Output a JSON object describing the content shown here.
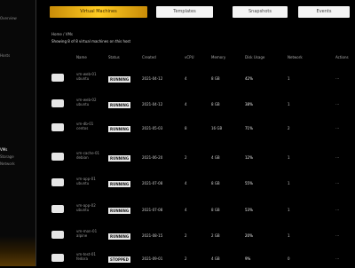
{
  "sidebar": {
    "items": [
      {
        "label": "Overview",
        "active": false
      },
      {
        "label": "Hosts",
        "active": false
      },
      {
        "label": "VMs",
        "active": true
      },
      {
        "label": "Storage",
        "active": false
      },
      {
        "label": "Network",
        "active": false
      }
    ]
  },
  "tabs": [
    {
      "label": "Virtual Machines",
      "active": true
    },
    {
      "label": "Templates",
      "active": false
    },
    {
      "label": "Snapshots",
      "active": false
    },
    {
      "label": "Events",
      "active": false
    }
  ],
  "breadcrumb": "Home / VMs",
  "caption": "Showing 8 of 8 virtual machines on this host",
  "table": {
    "headers": [
      "",
      "Name",
      "Status",
      "Created",
      "vCPU",
      "Memory",
      "Disk Usage",
      "Network",
      "Actions"
    ],
    "rows": [
      {
        "name": "vm-web-01 ubuntu",
        "status": "RUNNING",
        "created": "2021-04-12",
        "vcpu": "4",
        "memory": "8 GB",
        "disk": "42%",
        "network": "1",
        "actions": "⋯"
      },
      {
        "name": "vm-web-02 ubuntu",
        "status": "RUNNING",
        "created": "2021-04-12",
        "vcpu": "4",
        "memory": "8 GB",
        "disk": "38%",
        "network": "1",
        "actions": "⋯"
      },
      {
        "name": "vm-db-01 centos",
        "status": "RUNNING",
        "created": "2021-05-03",
        "vcpu": "8",
        "memory": "16 GB",
        "disk": "71%",
        "network": "2",
        "actions": "⋯"
      },
      {
        "name": "vm-cache-01 debian",
        "status": "RUNNING",
        "created": "2021-06-20",
        "vcpu": "2",
        "memory": "4 GB",
        "disk": "12%",
        "network": "1",
        "actions": "⋯"
      },
      {
        "name": "vm-app-01 ubuntu",
        "status": "RUNNING",
        "created": "2021-07-08",
        "vcpu": "4",
        "memory": "8 GB",
        "disk": "55%",
        "network": "1",
        "actions": "⋯"
      },
      {
        "name": "vm-app-02 ubuntu",
        "status": "RUNNING",
        "created": "2021-07-08",
        "vcpu": "4",
        "memory": "8 GB",
        "disk": "53%",
        "network": "1",
        "actions": "⋯"
      },
      {
        "name": "vm-mon-01 alpine",
        "status": "RUNNING",
        "created": "2021-08-15",
        "vcpu": "2",
        "memory": "2 GB",
        "disk": "20%",
        "network": "1",
        "actions": "⋯"
      },
      {
        "name": "vm-test-01 fedora",
        "status": "STOPPED",
        "created": "2021-09-01",
        "vcpu": "2",
        "memory": "4 GB",
        "disk": "9%",
        "network": "0",
        "actions": "⋯"
      }
    ]
  }
}
